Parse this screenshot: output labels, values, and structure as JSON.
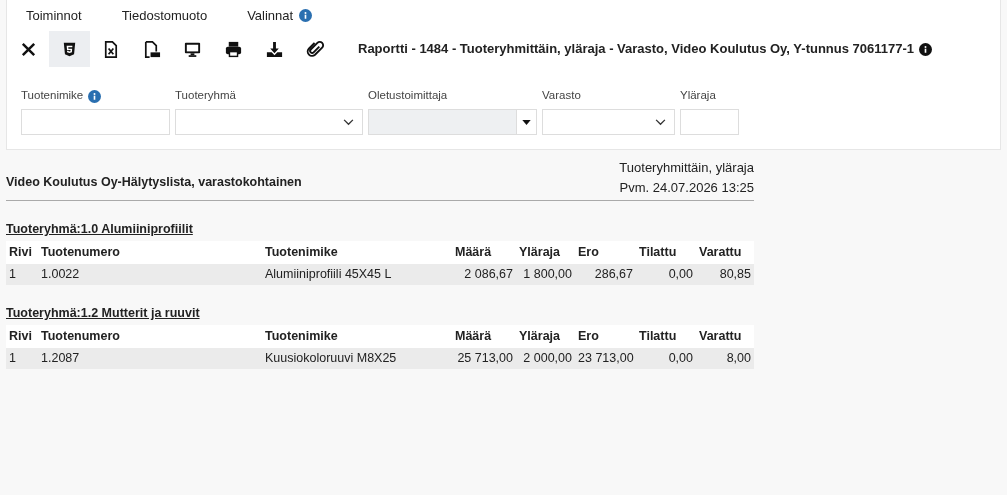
{
  "menu": [
    {
      "label": "Toiminnot",
      "info": false
    },
    {
      "label": "Tiedostomuoto",
      "info": false
    },
    {
      "label": "Valinnat",
      "info": true
    }
  ],
  "toolbar": [
    {
      "kind": "close",
      "selected": false
    },
    {
      "kind": "html",
      "selected": true
    },
    {
      "kind": "excel",
      "selected": false
    },
    {
      "kind": "pdf",
      "selected": false
    },
    {
      "kind": "screen",
      "selected": false
    },
    {
      "kind": "print",
      "selected": false
    },
    {
      "kind": "download",
      "selected": false
    },
    {
      "kind": "attach",
      "selected": false
    }
  ],
  "report_title": "Raportti - 1484 - Tuoteryhmittäin, yläraja - Varasto, Video Koulutus Oy, Y-tunnus 7061177-1",
  "filters": [
    {
      "label": "Tuotenimike",
      "kind": "text",
      "info": true,
      "disabled": false
    },
    {
      "label": "Tuoteryhmä",
      "kind": "select",
      "info": false,
      "disabled": false
    },
    {
      "label": "Oletustoimittaja",
      "kind": "combo",
      "info": false,
      "disabled": true
    },
    {
      "label": "Varasto",
      "kind": "select",
      "info": false,
      "disabled": false
    },
    {
      "label": "Yläraja",
      "kind": "number",
      "info": false,
      "disabled": false
    }
  ],
  "report": {
    "heading": "Video Koulutus Oy-Hälytyslista, varastokohtainen",
    "subtitle": "Tuoteryhmittäin, yläraja",
    "date": "Pvm. 24.07.2026 13:25",
    "groups": [
      {
        "title": "Tuoteryhmä:1.0 Alumiiniprofiilit",
        "columns": [
          "Rivi",
          "Tuotenumero",
          "Tuotenimike",
          "Määrä",
          "Yläraja",
          "Ero",
          "Tilattu",
          "Varattu"
        ],
        "rows": [
          [
            "1",
            "1.0022",
            "Alumiiniprofiili 45X45 L",
            "2 086,67",
            "1 800,00",
            "286,67",
            "0,00",
            "80,85"
          ]
        ]
      },
      {
        "title": "Tuoteryhmä:1.2 Mutterit ja ruuvit",
        "columns": [
          "Rivi",
          "Tuotenumero",
          "Tuotenimike",
          "Määrä",
          "Yläraja",
          "Ero",
          "Tilattu",
          "Varattu"
        ],
        "rows": [
          [
            "1",
            "1.2087",
            "Kuusiokoloruuvi M8X25",
            "25 713,00",
            "2 000,00",
            "23 713,00",
            "0,00",
            "8,00"
          ]
        ]
      }
    ]
  }
}
